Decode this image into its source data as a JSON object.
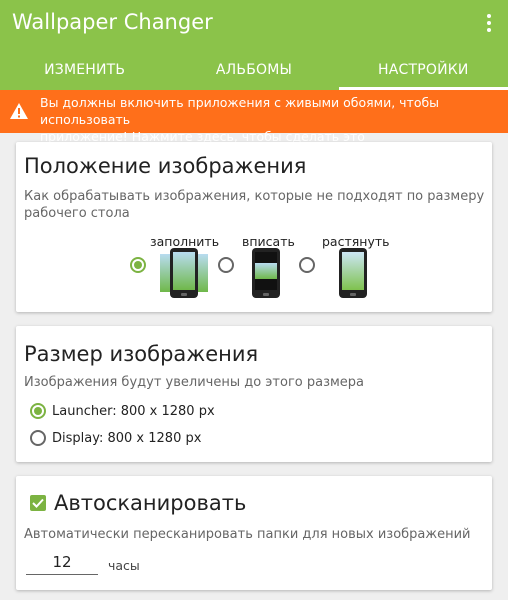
{
  "app": {
    "title": "Wallpaper Changer"
  },
  "tabs": [
    {
      "label": "ИЗМЕНИТЬ"
    },
    {
      "label": "АЛЬБОМЫ"
    },
    {
      "label": "НАСТРОЙКИ"
    }
  ],
  "banner": {
    "line1": "Вы должны включить приложения с живыми обоями, чтобы использовать",
    "line2": "приложение! Нажмите здесь, чтобы сделать это"
  },
  "image_position": {
    "title": "Положение изображения",
    "desc_line1": "Как обрабатывать изображения, которые не подходят по размеру",
    "desc_line2": "рабочего стола",
    "options": [
      {
        "label": "заполнить",
        "selected": true
      },
      {
        "label": "вписать",
        "selected": false
      },
      {
        "label": "растянуть",
        "selected": false
      }
    ]
  },
  "image_size": {
    "title": "Размер изображения",
    "desc": "Изображения будут увеличены до этого размера",
    "options": [
      {
        "label": "Launcher: 800 x 1280 px",
        "selected": true
      },
      {
        "label": "Display: 800 x 1280 px",
        "selected": false
      }
    ]
  },
  "autoscan": {
    "title": "Автосканировать",
    "checked": true,
    "desc": "Автоматически пересканировать папки для новых изображений",
    "value": "12",
    "unit": "часы"
  },
  "colors": {
    "accent": "#8bc34a",
    "banner": "#ff6f1a"
  }
}
